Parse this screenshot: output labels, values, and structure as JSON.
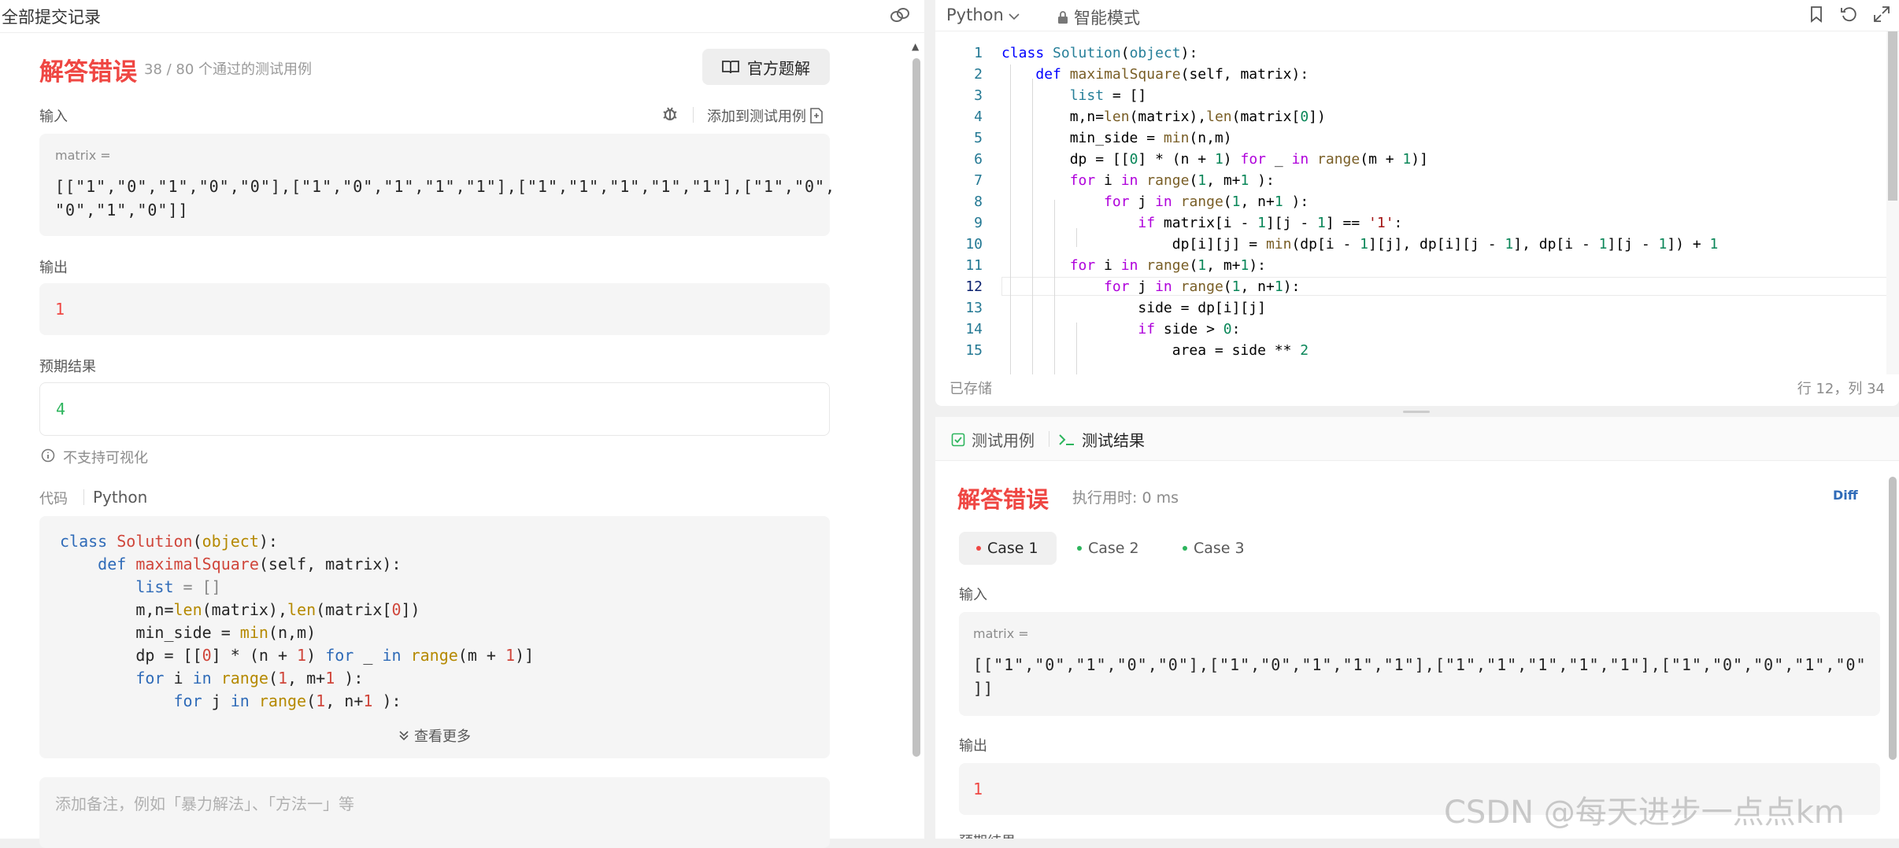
{
  "left_header": {
    "title": "全部提交记录"
  },
  "submission": {
    "status": "解答错误",
    "summary": "38 / 80 个通过的测试用例",
    "solution_button": "官方题解",
    "input_label": "输入",
    "add_test_label": "添加到测试用例",
    "input_var": "matrix =",
    "input_line1": "[[\"1\",\"0\",\"1\",\"0\",\"0\"],[\"1\",\"0\",\"1\",\"1\",\"1\"],[\"1\",\"1\",\"1\",\"1\",\"1\"],[\"1\",\"0\",",
    "input_line2": "\"0\",\"1\",\"0\"]]",
    "output_label": "输出",
    "output_value": "1",
    "expected_label": "预期结果",
    "expected_value": "4",
    "no_visual": "不支持可视化",
    "code_label": "代码",
    "code_lang": "Python",
    "show_more": "查看更多",
    "note_placeholder": "添加备注，例如「暴力解法」、「方法一」等"
  },
  "editor": {
    "language": "Python",
    "mode": "智能模式",
    "saved": "已存储",
    "cursor_pos": "行 12，列 34",
    "line_numbers": [
      "1",
      "2",
      "3",
      "4",
      "5",
      "6",
      "7",
      "8",
      "9",
      "10",
      "11",
      "12",
      "13",
      "14",
      "15"
    ]
  },
  "results": {
    "tab_testcase": "测试用例",
    "tab_result": "测试结果",
    "status": "解答错误",
    "runtime": "执行用时: 0 ms",
    "diff": "Diff",
    "cases": [
      "Case 1",
      "Case 2",
      "Case 3"
    ],
    "input_label": "输入",
    "input_var": "matrix =",
    "input_line1": "[[\"1\",\"0\",\"1\",\"0\",\"0\"],[\"1\",\"0\",\"1\",\"1\",\"1\"],[\"1\",\"1\",\"1\",\"1\",\"1\"],[\"1\",\"0\",\"0\",\"1\",\"0\"",
    "input_line2": "]]",
    "output_label": "输出",
    "output_value": "1",
    "expected_label_partial": "预期结果"
  },
  "watermark": "CSDN @每天进步一点点km",
  "colors": {
    "error": "#ef4743",
    "success": "#2db55d",
    "link": "#2f6bb8"
  }
}
